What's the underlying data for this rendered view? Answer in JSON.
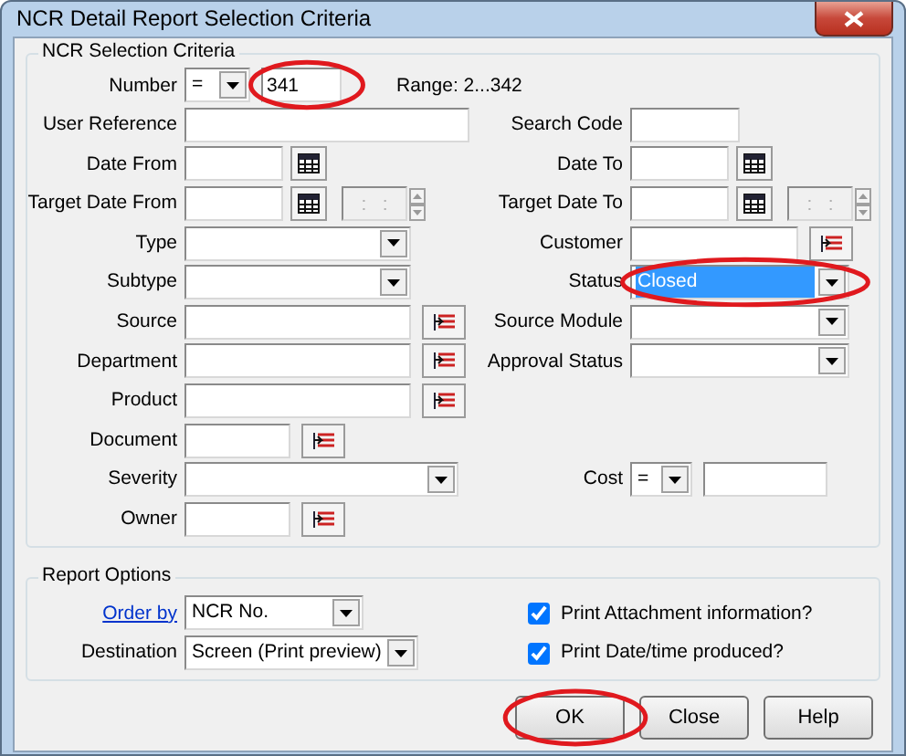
{
  "window": {
    "title": "NCR Detail Report Selection Criteria"
  },
  "selection_criteria": {
    "title": "NCR Selection Criteria",
    "rows": [
      {
        "left": {
          "label": "Number",
          "fields": [
            {
              "kind": "combo",
              "value": "="
            },
            {
              "kind": "text",
              "value": "341",
              "highlighted": true
            },
            {
              "kind": "note",
              "value": "Range: 2...342"
            }
          ]
        }
      },
      {
        "left": {
          "label": "User Reference",
          "fields": [
            {
              "kind": "text"
            }
          ]
        },
        "right": {
          "label": "Search Code",
          "fields": [
            {
              "kind": "text"
            }
          ]
        }
      },
      {
        "left": {
          "label": "Date From",
          "fields": [
            {
              "kind": "date"
            }
          ]
        },
        "right": {
          "label": "Date To",
          "fields": [
            {
              "kind": "date"
            }
          ]
        }
      },
      {
        "left": {
          "label": "Target Date From",
          "fields": [
            {
              "kind": "date"
            },
            {
              "kind": "time",
              "value": ":   :",
              "disabled": true
            }
          ]
        },
        "right": {
          "label": "Target Date To",
          "fields": [
            {
              "kind": "date"
            },
            {
              "kind": "time",
              "value": ":   :",
              "disabled": true
            }
          ]
        }
      },
      {
        "left": {
          "label": "Type",
          "fields": [
            {
              "kind": "combo"
            }
          ]
        },
        "right": {
          "label": "Customer",
          "fields": [
            {
              "kind": "lookup"
            }
          ]
        }
      },
      {
        "left": {
          "label": "Subtype",
          "fields": [
            {
              "kind": "combo"
            }
          ]
        },
        "right": {
          "label": "Status",
          "fields": [
            {
              "kind": "combo",
              "value": "Closed",
              "text_selected": true,
              "highlighted": true
            }
          ]
        }
      },
      {
        "left": {
          "label": "Source",
          "fields": [
            {
              "kind": "lookup"
            }
          ]
        },
        "right": {
          "label": "Source Module",
          "fields": [
            {
              "kind": "combo"
            }
          ]
        }
      },
      {
        "left": {
          "label": "Department",
          "fields": [
            {
              "kind": "lookup"
            }
          ]
        },
        "right": {
          "label": "Approval Status",
          "fields": [
            {
              "kind": "combo"
            }
          ]
        }
      },
      {
        "left": {
          "label": "Product",
          "fields": [
            {
              "kind": "lookup"
            }
          ]
        }
      },
      {
        "left": {
          "label": "Document",
          "fields": [
            {
              "kind": "lookup"
            }
          ]
        }
      },
      {
        "left": {
          "label": "Severity",
          "fields": [
            {
              "kind": "combo"
            }
          ]
        },
        "right": {
          "label": "Cost",
          "fields": [
            {
              "kind": "combo",
              "value": "="
            },
            {
              "kind": "text"
            }
          ]
        }
      },
      {
        "left": {
          "label": "Owner",
          "fields": [
            {
              "kind": "lookup"
            }
          ]
        }
      }
    ]
  },
  "report_options": {
    "title": "Report Options",
    "order_by": {
      "label": "Order by",
      "value": "NCR No."
    },
    "destination": {
      "label": "Destination",
      "value": "Screen (Print preview)"
    },
    "checkboxes": [
      {
        "label": "Print Attachment information?",
        "checked": true
      },
      {
        "label": "Print Date/time produced?",
        "checked": true
      }
    ]
  },
  "buttons": [
    {
      "label": "OK",
      "highlighted": true
    },
    {
      "label": "Close",
      "highlighted": false
    },
    {
      "label": "Help",
      "highlighted": false
    }
  ]
}
